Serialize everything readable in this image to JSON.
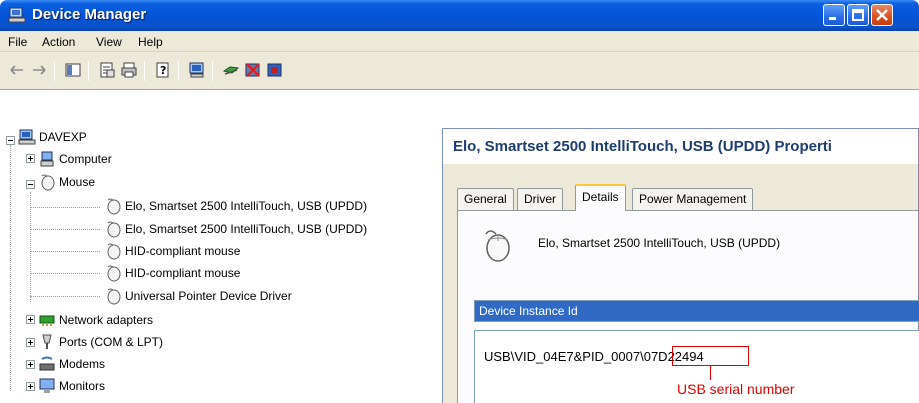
{
  "window": {
    "title": "Device Manager"
  },
  "menu": {
    "items": [
      "File",
      "Action",
      "View",
      "Help"
    ]
  },
  "toolbar": {
    "icons": [
      "back-arrow-icon",
      "forward-arrow-icon",
      "show-hide-console-tree-icon",
      "properties-icon",
      "print-icon",
      "help-icon",
      "scan-hardware-icon",
      "update-driver-icon",
      "uninstall-icon",
      "disable-icon"
    ]
  },
  "tree": {
    "root": "DAVEXP",
    "items": [
      {
        "label": "Computer",
        "level": 1,
        "expander": "plus"
      },
      {
        "label": "Mouse",
        "level": 1,
        "expander": "minus"
      },
      {
        "label": "Elo, Smartset 2500 IntelliTouch, USB (UPDD)",
        "level": 2
      },
      {
        "label": "Elo, Smartset 2500 IntelliTouch, USB (UPDD)",
        "level": 2
      },
      {
        "label": "HID-compliant mouse",
        "level": 2
      },
      {
        "label": "HID-compliant mouse",
        "level": 2
      },
      {
        "label": "Universal Pointer Device Driver",
        "level": 2
      },
      {
        "label": "Network adapters",
        "level": 1,
        "expander": "plus"
      },
      {
        "label": "Ports (COM & LPT)",
        "level": 1,
        "expander": "plus"
      },
      {
        "label": "Modems",
        "level": 1,
        "expander": "plus"
      },
      {
        "label": "Monitors",
        "level": 1,
        "expander": "plus"
      }
    ]
  },
  "dialog": {
    "title": "Elo, Smartset 2500 IntelliTouch, USB (UPDD) Properti",
    "tabs": [
      "General",
      "Driver",
      "Details",
      "Power Management"
    ],
    "active_tab": "Details",
    "device_name": "Elo, Smartset 2500 IntelliTouch, USB (UPDD)",
    "property_selected": "Device Instance Id",
    "value_prefix": "USB\\VID_04E7&PID_0007\\",
    "value_serial": "07D22494",
    "annotation": "USB serial number"
  },
  "colors": {
    "titlebar": "#0453d6",
    "selection": "#316ac5",
    "annotation": "#e00000",
    "active_tab_accent": "#ffc83c"
  }
}
